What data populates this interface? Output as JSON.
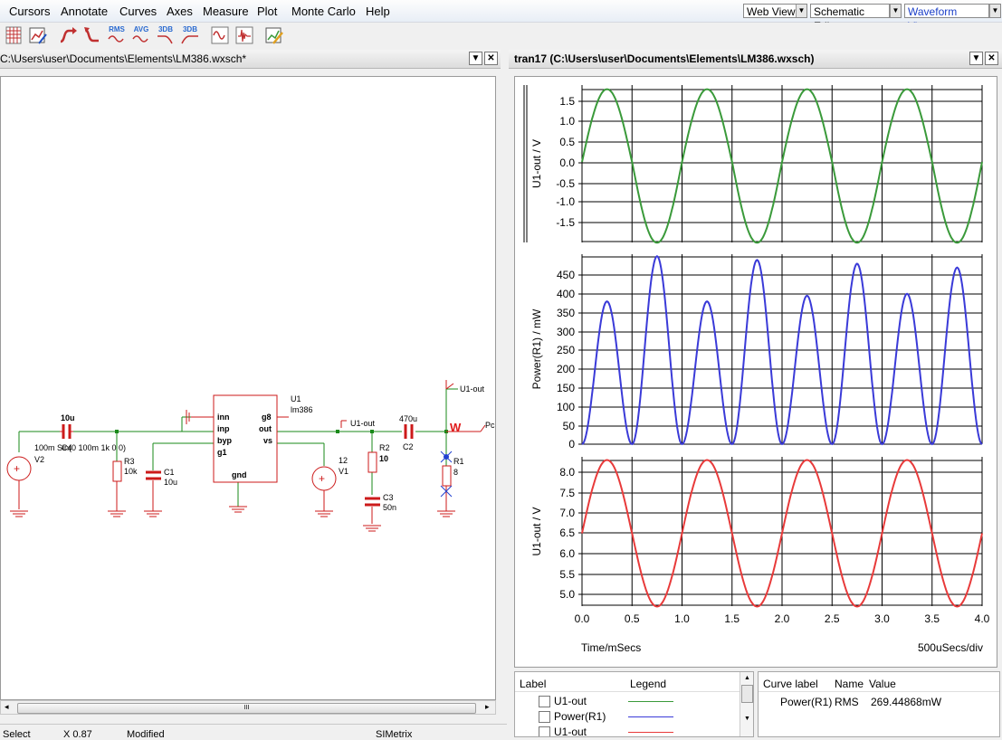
{
  "menu": [
    "Cursors",
    "Annotate",
    "Curves",
    "Axes",
    "Measure",
    "Plot",
    "Monte Carlo",
    "Help"
  ],
  "view_selectors": {
    "web_view": "Web View",
    "schematic_editor": "Schematic Editor",
    "waveform_viewer": "Waveform Viewer"
  },
  "toolbar": {
    "rms": "RMS",
    "avg": "AVG",
    "db1": "3DB",
    "db2": "3DB"
  },
  "schematic": {
    "title": "C:\\Users\\user\\Documents\\Elements\\LM386.wxsch*",
    "labels": {
      "c4_value": "10u",
      "c4_name": "C4",
      "v2_src": "100m Sin(0 100m 1k 0 0)",
      "v2_name": "V2",
      "r3_name": "R3",
      "r3_value": "10k",
      "c1_name": "C1",
      "c1_value": "10u",
      "u1_name": "U1",
      "u1_model": "lm386",
      "pin_inn": "inn",
      "pin_inp": "inp",
      "pin_byp": "byp",
      "pin_g1": "g1",
      "pin_g8": "g8",
      "pin_out": "out",
      "pin_vs": "vs",
      "pin_gnd": "gnd",
      "v1_value": "12",
      "v1_name": "V1",
      "net_u1out": "U1-out",
      "r2_name": "R2",
      "r2_value": "10",
      "c3_name": "C3",
      "c3_value": "50n",
      "c2_value": "470u",
      "c2_name": "C2",
      "probe_w": "W",
      "probe_pc": "Pc",
      "net_u1out2": "U1-out",
      "r1_name": "R1",
      "r1_value": "8"
    },
    "scroll_grip": "III"
  },
  "waveform": {
    "title": "tran17 (C:\\Users\\user\\Documents\\Elements\\LM386.wxsch)",
    "plots": [
      {
        "ylabel": "U1-out / V",
        "yticks": [
          "1.5",
          "1.0",
          "0.5",
          "0.0",
          "-0.5",
          "-1.0",
          "-1.5"
        ],
        "color": "#3a9a3a"
      },
      {
        "ylabel": "Power(R1) / mW",
        "yticks": [
          "450",
          "400",
          "350",
          "300",
          "250",
          "200",
          "150",
          "100",
          "50",
          "0"
        ],
        "color": "#3a3ad8"
      },
      {
        "ylabel": "U1-out / V",
        "yticks": [
          "8.0",
          "7.5",
          "7.0",
          "6.5",
          "6.0",
          "5.5",
          "5.0"
        ],
        "color": "#e83a3a"
      }
    ],
    "xticks": [
      "0.0",
      "0.5",
      "1.0",
      "1.5",
      "2.0",
      "2.5",
      "3.0",
      "3.5",
      "4.0"
    ],
    "xlabel": "Time/mSecs",
    "xdiv": "500uSecs/div"
  },
  "legend": {
    "headers": {
      "label": "Label",
      "legend": "Legend"
    },
    "rows": [
      {
        "label": "U1-out",
        "color": "#3a9a3a"
      },
      {
        "label": "Power(R1)",
        "color": "#3a3ad8"
      },
      {
        "label": "U1-out",
        "color": "#e83a3a"
      }
    ]
  },
  "measurements": {
    "headers": {
      "curve_label": "Curve label",
      "name": "Name",
      "value": "Value"
    },
    "row": {
      "curve_label": "Power(R1)",
      "name": "RMS",
      "value": "269.44868mW"
    }
  },
  "status": {
    "mode": "Select",
    "x": "X 0.87",
    "modified": "Modified",
    "app": "SIMetrix"
  },
  "chart_data": [
    {
      "type": "line",
      "title": "",
      "x": [
        0,
        0.25,
        0.5,
        0.75,
        1.0,
        1.25,
        1.5,
        1.75,
        2.0,
        2.25,
        2.5,
        2.75,
        3.0,
        3.25,
        3.5,
        3.75,
        4.0
      ],
      "series": [
        {
          "name": "U1-out",
          "values": [
            0,
            1.8,
            0,
            -2.0,
            0,
            1.8,
            0,
            -2.0,
            0,
            1.8,
            0,
            -2.0,
            0,
            1.8,
            0,
            -2.0,
            0
          ]
        }
      ],
      "xlabel": "Time/mSecs",
      "ylabel": "U1-out / V",
      "ylim": [
        -2.0,
        1.9
      ],
      "xlim": [
        0,
        4.0
      ],
      "grid": true
    },
    {
      "type": "line",
      "title": "",
      "x": [
        0,
        0.25,
        0.5,
        0.75,
        1.0,
        1.25,
        1.5,
        1.75,
        2.0,
        2.25,
        2.5,
        2.75,
        3.0,
        3.25,
        3.5,
        3.75,
        4.0
      ],
      "series": [
        {
          "name": "Power(R1)",
          "values": [
            0,
            380,
            0,
            500,
            0,
            380,
            0,
            490,
            0,
            395,
            0,
            480,
            0,
            400,
            0,
            470,
            0
          ]
        }
      ],
      "xlabel": "Time/mSecs",
      "ylabel": "Power(R1) / mW",
      "ylim": [
        0,
        500
      ],
      "xlim": [
        0,
        4.0
      ],
      "grid": true
    },
    {
      "type": "line",
      "title": "",
      "x": [
        0,
        0.25,
        0.5,
        0.75,
        1.0,
        1.25,
        1.5,
        1.75,
        2.0,
        2.25,
        2.5,
        2.75,
        3.0,
        3.25,
        3.5,
        3.75,
        4.0
      ],
      "series": [
        {
          "name": "U1-out",
          "values": [
            6.5,
            8.3,
            6.5,
            4.7,
            6.5,
            8.3,
            6.5,
            4.7,
            6.5,
            8.3,
            6.5,
            4.7,
            6.5,
            8.3,
            6.5,
            4.7,
            6.5
          ]
        }
      ],
      "xlabel": "Time/mSecs",
      "ylabel": "U1-out / V",
      "ylim": [
        4.6,
        8.4
      ],
      "xlim": [
        0,
        4.0
      ],
      "grid": true
    }
  ]
}
